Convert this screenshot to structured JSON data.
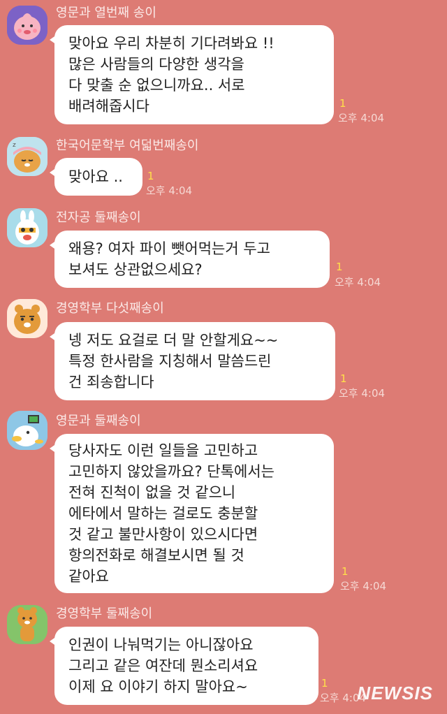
{
  "messages": [
    {
      "sender": "영문과 열번째 송이",
      "lines": [
        "맞아요 우리 차분히 기다려봐요 !!",
        "많은 사람들의 다양한 생각을",
        "다 맞출 순 없으니까요.. 서로",
        "배려해줍시다"
      ],
      "unread": "1",
      "time": "오후 4:04",
      "avatar_icon": "apeach-avatar-icon"
    },
    {
      "sender": "한국어문학부 여덟번째송이",
      "lines": [
        "맞아요 .."
      ],
      "unread": "1",
      "time": "오후 4:04",
      "avatar_icon": "ryan-sleeping-avatar-icon"
    },
    {
      "sender": "전자공 둘째송이",
      "lines": [
        "왜용? 여자 파이 뺏어먹는거 두고",
        "보셔도 상관없으세요?"
      ],
      "unread": "1",
      "time": "오후 4:04",
      "avatar_icon": "muzi-avatar-icon"
    },
    {
      "sender": "경영학부 다섯째송이",
      "lines": [
        "넹 저도 요걸로 더 말 안할게요~~",
        "특정 한사람을 지칭해서 말씀드린",
        "건 죄송합니다"
      ],
      "unread": "1",
      "time": "오후 4:04",
      "avatar_icon": "ryan-avatar-icon"
    },
    {
      "sender": "영문과 둘째송이",
      "lines": [
        "당사자도 이런 일들을 고민하고",
        "고민하지 않았을까요? 단톡에서는",
        "전혀 진척이 없을 것 같으니",
        "에타에서 말하는 걸로도 충분할",
        "것 같고 불만사항이 있으시다면",
        "항의전화로 해결보시면 될 것",
        "같아요"
      ],
      "unread": "1",
      "time": "오후 4:04",
      "avatar_icon": "duck-avatar-icon"
    },
    {
      "sender": "경영학부 둘째송이",
      "lines": [
        "인권이 나눠먹기는 아니잖아요",
        "그리고 같은 여잔데 뭔소리셔요",
        "이제 요 이야기 하지 말아요~"
      ],
      "unread": "1",
      "time": "오후 4:04",
      "avatar_icon": "ryan-standing-avatar-icon"
    }
  ],
  "watermark": "NEWSIS",
  "colors": {
    "background": "#dd7b74",
    "bubble": "#ffffff",
    "unread": "#ffe04a"
  }
}
